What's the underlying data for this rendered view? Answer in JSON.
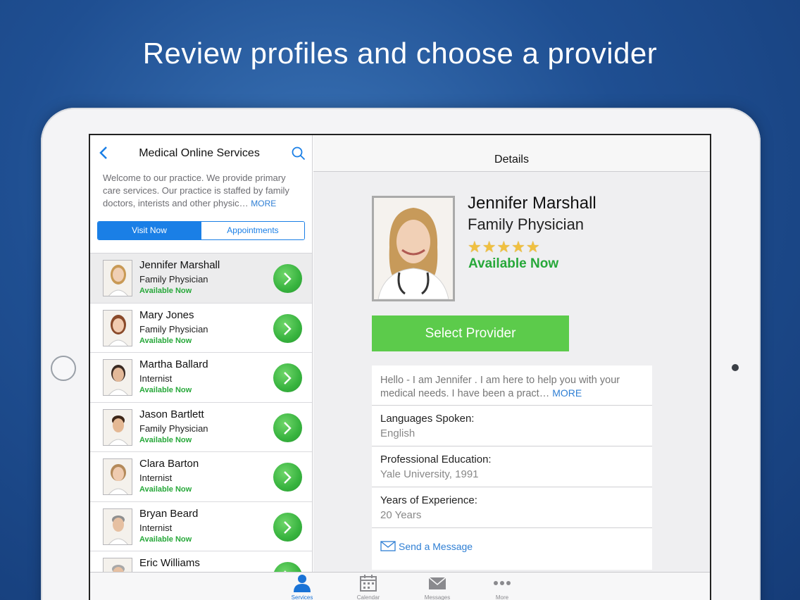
{
  "headline": "Review profiles and choose a provider",
  "left_panel": {
    "title": "Medical Online Services",
    "intro_text": "Welcome to our practice. We provide primary care services. Our practice is staffed by family doctors, interists and other physic…",
    "intro_more": "MORE",
    "segments": [
      "Visit Now",
      "Appointments"
    ],
    "providers": [
      {
        "name": "Jennifer Marshall",
        "specialty": "Family Physician",
        "status": "Available Now"
      },
      {
        "name": "Mary Jones",
        "specialty": "Family Physician",
        "status": "Available Now"
      },
      {
        "name": "Martha Ballard",
        "specialty": "Internist",
        "status": "Available Now"
      },
      {
        "name": "Jason Bartlett",
        "specialty": "Family Physician",
        "status": "Available Now"
      },
      {
        "name": "Clara Barton",
        "specialty": "Internist",
        "status": "Available Now"
      },
      {
        "name": "Bryan Beard",
        "specialty": "Internist",
        "status": "Available Now"
      },
      {
        "name": "Eric Williams",
        "specialty": "",
        "status": ""
      }
    ]
  },
  "details": {
    "header": "Details",
    "name": "Jennifer Marshall",
    "specialty": "Family Physician",
    "rating_stars": "★★★★★",
    "status": "Available Now",
    "select_button": "Select Provider",
    "bio": "Hello - I am Jennifer  . I am here to help you with your medical needs. I have been a pract…",
    "bio_more": "MORE",
    "fields": [
      {
        "label": "Languages Spoken:",
        "value": "English"
      },
      {
        "label": "Professional Education:",
        "value": "Yale University, 1991"
      },
      {
        "label": "Years of Experience:",
        "value": "20 Years"
      }
    ],
    "send_message": "Send a Message"
  },
  "tabbar": {
    "tabs": [
      "Services",
      "Calendar",
      "Messages",
      "More"
    ],
    "active": "Services"
  },
  "colors": {
    "accent_blue": "#1a7fe6",
    "available_green": "#27a83a",
    "select_button_green": "#5ccb4b",
    "star_gold": "#f0c040"
  }
}
